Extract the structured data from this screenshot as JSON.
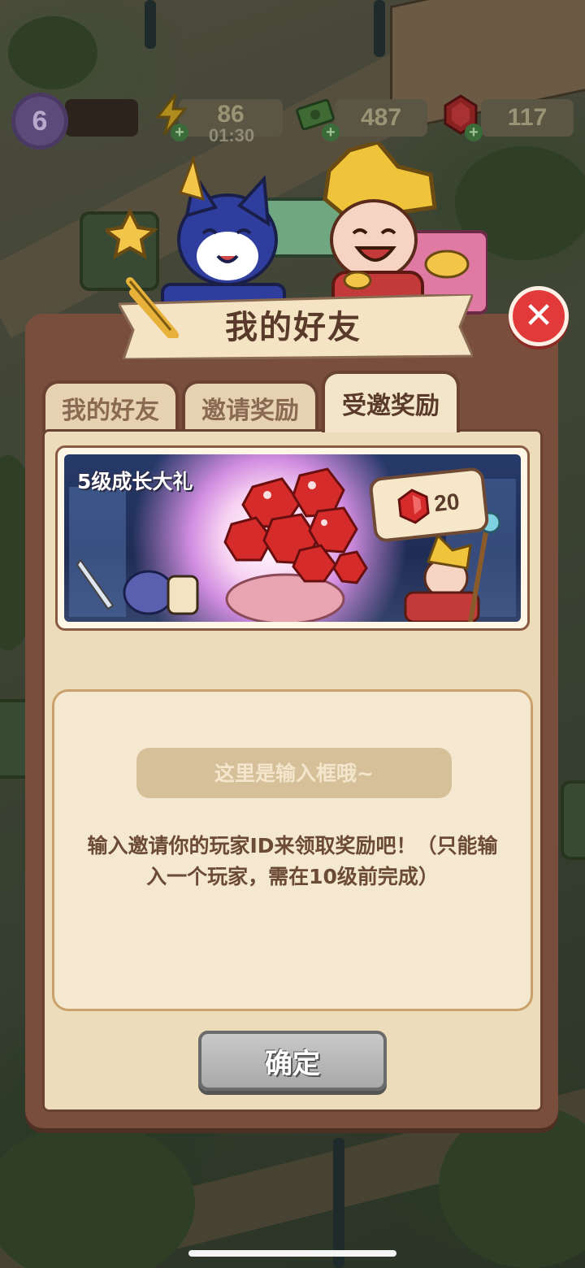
{
  "hud": {
    "level": "6",
    "energy": "86",
    "energy_timer": "01:30",
    "cash": "487",
    "gems": "117"
  },
  "dialog": {
    "title": "我的好友",
    "tabs": [
      {
        "label": "我的好友",
        "active": false
      },
      {
        "label": "邀请奖励",
        "active": false
      },
      {
        "label": "受邀奖励",
        "active": true
      }
    ],
    "reward": {
      "title": "5级成长大礼",
      "gem_count": "20"
    },
    "input": {
      "placeholder": "这里是输入框哦~"
    },
    "hint": "输入邀请你的玩家ID来领取奖励吧！（只能输入一个玩家，需在10级前完成）",
    "confirm_label": "确定"
  },
  "colors": {
    "dialog_frame": "#7a4e3d",
    "panel_bg": "#eddcba",
    "close_red": "#e23a3a",
    "gem_red": "#d62b2b"
  },
  "icons": [
    "level-badge-icon",
    "energy-icon",
    "cash-icon",
    "gem-icon",
    "close-icon",
    "gem-icon"
  ]
}
